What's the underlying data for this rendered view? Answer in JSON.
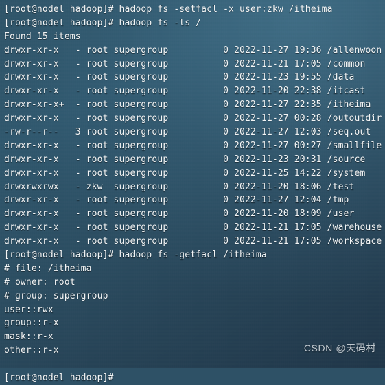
{
  "terminal": {
    "prompt": "[root@nodel hadoop]#",
    "colors": {
      "background_top": "#30586e",
      "background_bottom": "#21374a",
      "foreground": "#f3f5f6",
      "watermark": "#e9eef1"
    },
    "lines": [
      "[root@nodel hadoop]# hadoop fs -setfacl -x user:zkw /itheima",
      "[root@nodel hadoop]# hadoop fs -ls /",
      "Found 15 items",
      "drwxr-xr-x   - root supergroup          0 2022-11-27 19:36 /allenwoon",
      "drwxr-xr-x   - root supergroup          0 2022-11-21 17:05 /common",
      "drwxr-xr-x   - root supergroup          0 2022-11-23 19:55 /data",
      "drwxr-xr-x   - root supergroup          0 2022-11-20 22:38 /itcast",
      "drwxr-xr-x+  - root supergroup          0 2022-11-27 22:35 /itheima",
      "drwxr-xr-x   - root supergroup          0 2022-11-27 00:28 /outoutdir",
      "-rw-r--r--   3 root supergroup          0 2022-11-27 12:03 /seq.out",
      "drwxr-xr-x   - root supergroup          0 2022-11-27 00:27 /smallfile",
      "drwxr-xr-x   - root supergroup          0 2022-11-23 20:31 /source",
      "drwxr-xr-x   - root supergroup          0 2022-11-25 14:22 /system",
      "drwxrwxrwx   - zkw  supergroup          0 2022-11-20 18:06 /test",
      "drwxr-xr-x   - root supergroup          0 2022-11-27 12:04 /tmp",
      "drwxr-xr-x   - root supergroup          0 2022-11-20 18:09 /user",
      "drwxr-xr-x   - root supergroup          0 2022-11-21 17:05 /warehouse",
      "drwxr-xr-x   - root supergroup          0 2022-11-21 17:05 /workspace",
      "[root@nodel hadoop]# hadoop fs -getfacl /itheima",
      "# file: /itheima",
      "# owner: root",
      "# group: supergroup",
      "user::rwx",
      "group::r-x",
      "mask::r-x",
      "other::r-x",
      "",
      "[root@nodel hadoop]#"
    ],
    "commands": [
      "hadoop fs -setfacl -x user:zkw /itheima",
      "hadoop fs -ls /",
      "hadoop fs -getfacl /itheima"
    ],
    "listing": {
      "header": "Found 15 items",
      "item_count": 15,
      "rows": [
        {
          "permissions": "drwxr-xr-x",
          "replication": "-",
          "owner": "root",
          "group": "supergroup",
          "size": "0",
          "date": "2022-11-27",
          "time": "19:36",
          "path": "/allenwoon"
        },
        {
          "permissions": "drwxr-xr-x",
          "replication": "-",
          "owner": "root",
          "group": "supergroup",
          "size": "0",
          "date": "2022-11-21",
          "time": "17:05",
          "path": "/common"
        },
        {
          "permissions": "drwxr-xr-x",
          "replication": "-",
          "owner": "root",
          "group": "supergroup",
          "size": "0",
          "date": "2022-11-23",
          "time": "19:55",
          "path": "/data"
        },
        {
          "permissions": "drwxr-xr-x",
          "replication": "-",
          "owner": "root",
          "group": "supergroup",
          "size": "0",
          "date": "2022-11-20",
          "time": "22:38",
          "path": "/itcast"
        },
        {
          "permissions": "drwxr-xr-x+",
          "replication": "-",
          "owner": "root",
          "group": "supergroup",
          "size": "0",
          "date": "2022-11-27",
          "time": "22:35",
          "path": "/itheima"
        },
        {
          "permissions": "drwxr-xr-x",
          "replication": "-",
          "owner": "root",
          "group": "supergroup",
          "size": "0",
          "date": "2022-11-27",
          "time": "00:28",
          "path": "/outoutdir"
        },
        {
          "permissions": "-rw-r--r--",
          "replication": "3",
          "owner": "root",
          "group": "supergroup",
          "size": "0",
          "date": "2022-11-27",
          "time": "12:03",
          "path": "/seq.out"
        },
        {
          "permissions": "drwxr-xr-x",
          "replication": "-",
          "owner": "root",
          "group": "supergroup",
          "size": "0",
          "date": "2022-11-27",
          "time": "00:27",
          "path": "/smallfile"
        },
        {
          "permissions": "drwxr-xr-x",
          "replication": "-",
          "owner": "root",
          "group": "supergroup",
          "size": "0",
          "date": "2022-11-23",
          "time": "20:31",
          "path": "/source"
        },
        {
          "permissions": "drwxr-xr-x",
          "replication": "-",
          "owner": "root",
          "group": "supergroup",
          "size": "0",
          "date": "2022-11-25",
          "time": "14:22",
          "path": "/system"
        },
        {
          "permissions": "drwxrwxrwx",
          "replication": "-",
          "owner": "zkw",
          "group": "supergroup",
          "size": "0",
          "date": "2022-11-20",
          "time": "18:06",
          "path": "/test"
        },
        {
          "permissions": "drwxr-xr-x",
          "replication": "-",
          "owner": "root",
          "group": "supergroup",
          "size": "0",
          "date": "2022-11-27",
          "time": "12:04",
          "path": "/tmp"
        },
        {
          "permissions": "drwxr-xr-x",
          "replication": "-",
          "owner": "root",
          "group": "supergroup",
          "size": "0",
          "date": "2022-11-20",
          "time": "18:09",
          "path": "/user"
        },
        {
          "permissions": "drwxr-xr-x",
          "replication": "-",
          "owner": "root",
          "group": "supergroup",
          "size": "0",
          "date": "2022-11-21",
          "time": "17:05",
          "path": "/warehouse"
        },
        {
          "permissions": "drwxr-xr-x",
          "replication": "-",
          "owner": "root",
          "group": "supergroup",
          "size": "0",
          "date": "2022-11-21",
          "time": "17:05",
          "path": "/workspace"
        }
      ]
    },
    "facl_output": {
      "file": "# file: /itheima",
      "owner": "# owner: root",
      "group": "# group: supergroup",
      "entries": [
        "user::rwx",
        "group::r-x",
        "mask::r-x",
        "other::r-x"
      ]
    }
  },
  "watermark": {
    "text": "CSDN @天码村"
  }
}
